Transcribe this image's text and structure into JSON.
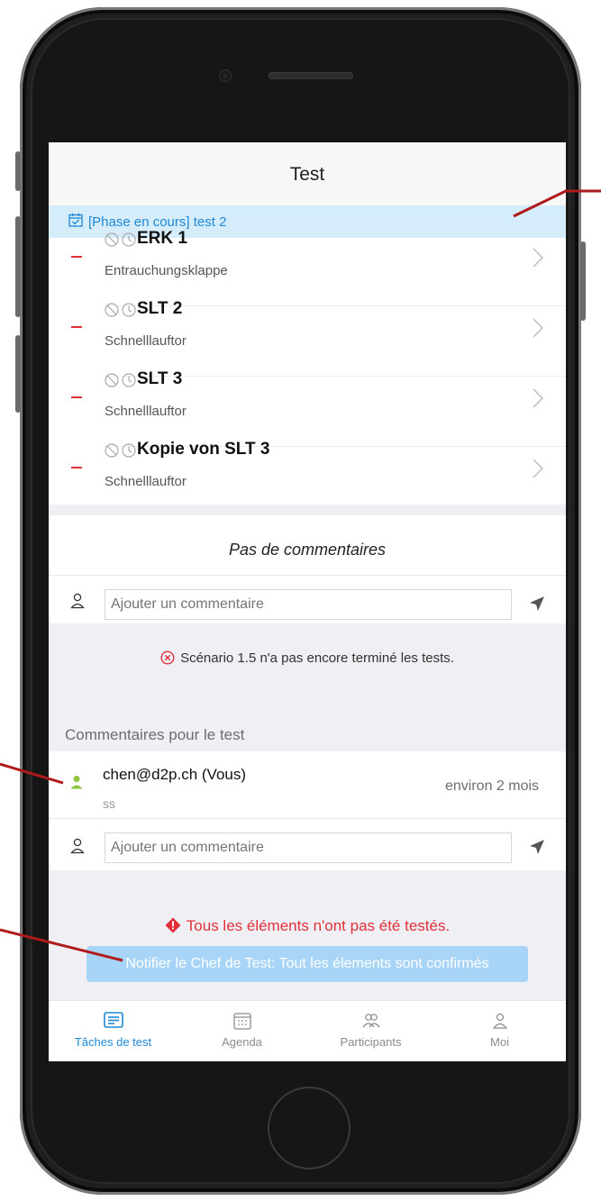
{
  "nav": {
    "title": "Test"
  },
  "phase": {
    "label": "[Phase en cours] test 2"
  },
  "items": [
    {
      "title": "ERK 1",
      "subtitle": "Entrauchungsklappe"
    },
    {
      "title": "SLT 2",
      "subtitle": "Schnelllauftor"
    },
    {
      "title": "SLT 3",
      "subtitle": "Schnelllauftor"
    },
    {
      "title": "Kopie von SLT 3",
      "subtitle": "Schnelllauftor"
    }
  ],
  "comments": {
    "empty_label": "Pas de commentaires",
    "placeholder": "Ajouter un commentaire"
  },
  "status": {
    "error": "Scénario 1.5 n'a pas encore terminé les tests."
  },
  "test_comments": {
    "section_title": "Commentaires pour le test",
    "author": "chen@d2p.ch (Vous)",
    "time": "environ 2 mois",
    "body": "ss",
    "placeholder": "Ajouter un commentaire"
  },
  "warning": {
    "text": "Tous les éléments n'ont pas été testés."
  },
  "notify_button": {
    "label": "Notifier le Chef de Test: Tout les élements sont confirmés"
  },
  "tabs": [
    {
      "label": "Tâches de test",
      "icon": "tasks-icon",
      "active": true
    },
    {
      "label": "Agenda",
      "icon": "calendar-icon",
      "active": false
    },
    {
      "label": "Participants",
      "icon": "participants-icon",
      "active": false
    },
    {
      "label": "Moi",
      "icon": "user-icon",
      "active": false
    }
  ],
  "colors": {
    "accent": "#1c88d6",
    "error": "#e0313a",
    "phase_bg": "#d5ecfa",
    "notify_bg": "#a8d4f7",
    "author_dot": "#8cc63f",
    "annotation": "#b11a1a"
  }
}
